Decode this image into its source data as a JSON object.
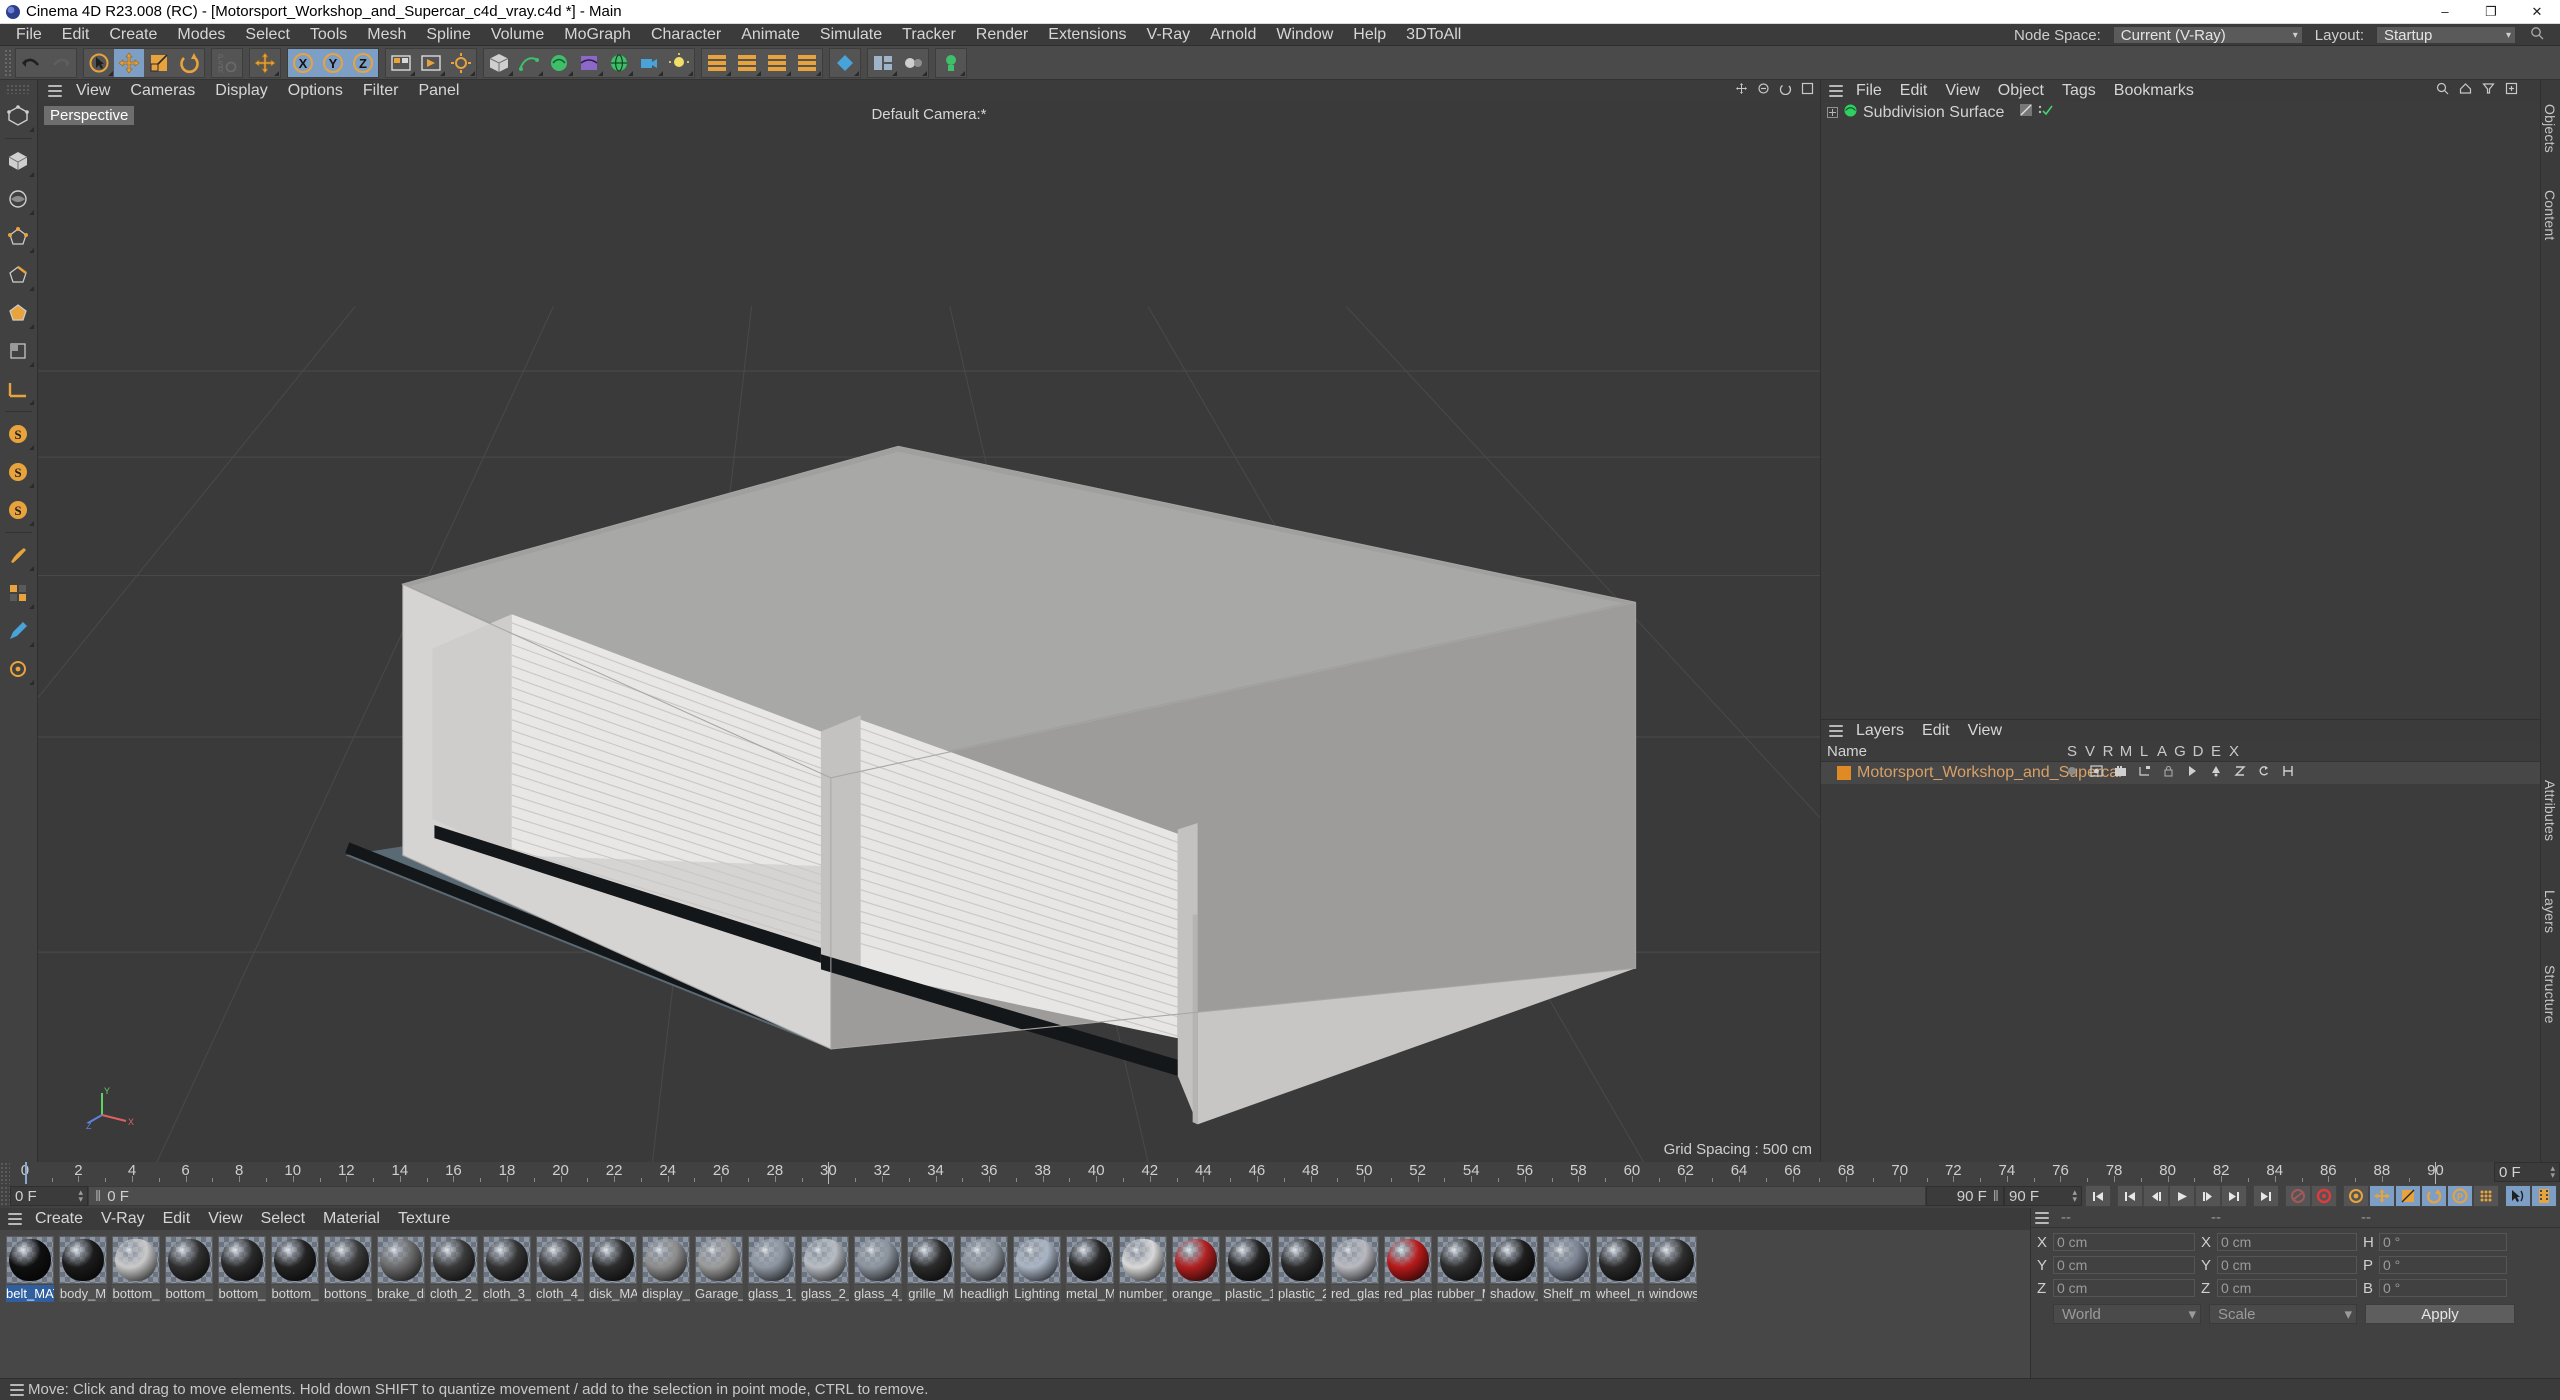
{
  "window": {
    "title": "Cinema 4D R23.008 (RC) - [Motorsport_Workshop_and_Supercar_c4d_vray.c4d *] - Main",
    "minimize": "–",
    "maximize": "❐",
    "close": "✕"
  },
  "menubar": {
    "items": [
      "File",
      "Edit",
      "Create",
      "Modes",
      "Select",
      "Tools",
      "Mesh",
      "Spline",
      "Volume",
      "MoGraph",
      "Character",
      "Animate",
      "Simulate",
      "Tracker",
      "Render",
      "Extensions",
      "V-Ray",
      "Arnold",
      "Window",
      "Help",
      "3DToAll"
    ],
    "node_space_label": "Node Space:",
    "node_space_value": "Current (V-Ray)",
    "layout_label": "Layout:",
    "layout_value": "Startup"
  },
  "viewport": {
    "menu": [
      "View",
      "Cameras",
      "Display",
      "Options",
      "Filter",
      "Panel"
    ],
    "projection_label": "Perspective",
    "camera_label": "Default Camera:*",
    "grid_spacing": "Grid Spacing : 500 cm",
    "axis_x": "X",
    "axis_y": "Y",
    "axis_z": "Z"
  },
  "object_manager": {
    "menu": [
      "File",
      "Edit",
      "View",
      "Object",
      "Tags",
      "Bookmarks"
    ],
    "rows": [
      {
        "label": "Subdivision Surface"
      }
    ]
  },
  "layer_manager": {
    "menu": [
      "Layers",
      "Edit",
      "View"
    ],
    "columns": [
      "Name",
      "S",
      "V",
      "R",
      "M",
      "L",
      "A",
      "G",
      "D",
      "E",
      "X"
    ],
    "rows": [
      {
        "label": "Motorsport_Workshop_and_Supercar",
        "color": "#e08a26"
      }
    ]
  },
  "right_tabs": [
    "Objects",
    "Attributes",
    "Layers",
    "Structure",
    "Content"
  ],
  "timeline": {
    "ticks": [
      0,
      2,
      4,
      6,
      8,
      10,
      12,
      14,
      16,
      18,
      20,
      22,
      24,
      26,
      28,
      30,
      32,
      34,
      36,
      38,
      40,
      42,
      44,
      46,
      48,
      50,
      52,
      54,
      56,
      58,
      60,
      62,
      64,
      66,
      68,
      70,
      72,
      74,
      76,
      78,
      80,
      82,
      84,
      86,
      88,
      90
    ],
    "current_frame": "0 F",
    "preview_start": "0 F",
    "preview_end": "90 F",
    "end_frame": "90 F",
    "range_value": "0 F",
    "fps_display": "90 F"
  },
  "material_manager": {
    "menu": [
      "Create",
      "V-Ray",
      "Edit",
      "View",
      "Select",
      "Material",
      "Texture"
    ],
    "materials": [
      {
        "name": "belt_MAT",
        "color": "#101010",
        "selected": true
      },
      {
        "name": "body_M",
        "color": "#1b1b1b",
        "selected": false
      },
      {
        "name": "bottom_",
        "color": "#c9c9c9",
        "selected": false
      },
      {
        "name": "bottom_",
        "color": "#303030",
        "selected": false
      },
      {
        "name": "bottom_",
        "color": "#2a2a2a",
        "selected": false
      },
      {
        "name": "bottom_",
        "color": "#242424",
        "selected": false
      },
      {
        "name": "bottons_",
        "color": "#3a3a3a",
        "selected": false
      },
      {
        "name": "brake_di",
        "color": "#6a6a6a",
        "selected": false
      },
      {
        "name": "cloth_2_",
        "color": "#3a3a3a",
        "selected": false
      },
      {
        "name": "cloth_3_",
        "color": "#343434",
        "selected": false
      },
      {
        "name": "cloth_4_",
        "color": "#383838",
        "selected": false
      },
      {
        "name": "disk_MA",
        "color": "#2c2c2c",
        "selected": false
      },
      {
        "name": "display_",
        "color": "#8d8d8d",
        "selected": false
      },
      {
        "name": "Garage_",
        "color": "#9a9a9a",
        "selected": false
      },
      {
        "name": "glass_1_",
        "color": "#8e97a2",
        "selected": false
      },
      {
        "name": "glass_2_",
        "color": "#b7bcc2",
        "selected": false
      },
      {
        "name": "glass_4_",
        "color": "#8c949e",
        "selected": false
      },
      {
        "name": "grille_M",
        "color": "#2b2b2b",
        "selected": false
      },
      {
        "name": "headligh",
        "color": "#8d949c",
        "selected": false
      },
      {
        "name": "Lighting",
        "color": "#a9b4c4",
        "selected": false
      },
      {
        "name": "metal_M",
        "color": "#262626",
        "selected": false
      },
      {
        "name": "number_",
        "color": "#d8d8d8",
        "selected": false
      },
      {
        "name": "orange_g",
        "color": "#b02020",
        "selected": false
      },
      {
        "name": "plastic_1",
        "color": "#222222",
        "selected": false
      },
      {
        "name": "plastic_2",
        "color": "#2a2a2a",
        "selected": false
      },
      {
        "name": "red_glas",
        "color": "#b9b9c0",
        "selected": false
      },
      {
        "name": "red_plas",
        "color": "#b81a1a",
        "selected": false
      },
      {
        "name": "rubber_M",
        "color": "#2e2e2e",
        "selected": false
      },
      {
        "name": "shadow_",
        "color": "#1e1e1e",
        "selected": false
      },
      {
        "name": "Shelf_ma",
        "color": "#7f8795",
        "selected": false
      },
      {
        "name": "wheel_ru",
        "color": "#2a2a2a",
        "selected": false
      },
      {
        "name": "windows",
        "color": "#2e2e2e",
        "selected": false
      }
    ]
  },
  "coordinates": {
    "header_dashes": [
      "--",
      "--",
      "--"
    ],
    "position": {
      "label_x": "X",
      "label_y": "Y",
      "label_z": "Z",
      "x": "0 cm",
      "y": "0 cm",
      "z": "0 cm"
    },
    "size": {
      "label_x": "X",
      "label_y": "Y",
      "label_z": "Z",
      "x": "0 cm",
      "y": "0 cm",
      "z": "0 cm"
    },
    "rotation": {
      "label_h": "H",
      "label_p": "P",
      "label_b": "B",
      "h": "0 °",
      "p": "0 °",
      "b": "0 °"
    },
    "system": "World",
    "mode": "Scale",
    "apply": "Apply"
  },
  "statusbar": {
    "text": "Move: Click and drag to move elements. Hold down SHIFT to quantize movement / add to the selection in point mode, CTRL to remove."
  },
  "colors": {
    "accent_orange": "#e08a26",
    "selection_blue": "#7d9fc6",
    "panel_bg": "#414141",
    "viewport_bg": "#3a3a3a"
  }
}
